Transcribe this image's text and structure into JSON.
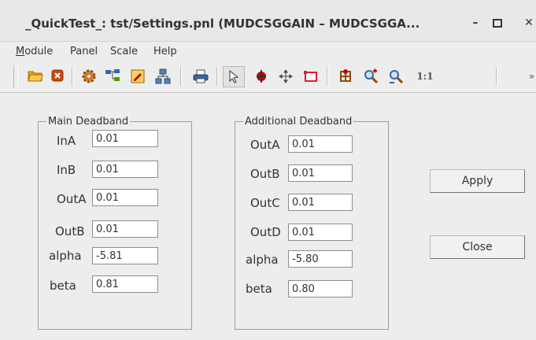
{
  "window": {
    "title": "_QuickTest_: tst/Settings.pnl (MUDCSGGAIN – MUDCSGGA...",
    "minimize_glyph": "–",
    "close_glyph": "✕"
  },
  "menu": [
    {
      "label": "Module",
      "accel": "M",
      "rest": "odule"
    },
    {
      "label": "Panel"
    },
    {
      "label": "Scale"
    },
    {
      "label": "Help"
    }
  ],
  "toolbar": {
    "icons": [
      "open-folder-icon",
      "stop-icon",
      "settings-gear-icon",
      "hierarchy-icon",
      "panel-edit-icon",
      "network-icon",
      "print-icon",
      "pointer-icon",
      "select-object-icon",
      "move-icon",
      "rectangle-icon",
      "grid-icon",
      "zoom-in-icon",
      "zoom-out-icon",
      "zoom-1-1-icon"
    ],
    "one_to_one_label": "1:1",
    "overflow_glyph": "»",
    "selected_tool": "pointer-icon",
    "colors": {
      "folder": "#e5a50a",
      "stop": "#cc4a0c",
      "rectangle": "#e01b24",
      "accent_blue": "#3465a4"
    }
  },
  "main_deadband": {
    "legend": "Main Deadband",
    "fields": [
      {
        "label": "InA",
        "value": "0.01"
      },
      {
        "label": "InB",
        "value": "0.01"
      },
      {
        "label": "OutA",
        "value": "0.01"
      },
      {
        "label": "OutB",
        "value": "0.01"
      },
      {
        "label": "alpha",
        "value": "-5.81"
      },
      {
        "label": "beta",
        "value": "0.81"
      }
    ]
  },
  "additional_deadband": {
    "legend": "Additional Deadband",
    "fields": [
      {
        "label": "OutA",
        "value": "0.01"
      },
      {
        "label": "OutB",
        "value": "0.01"
      },
      {
        "label": "OutC",
        "value": "0.01"
      },
      {
        "label": "OutD",
        "value": "0.01"
      },
      {
        "label": "alpha",
        "value": "-5.80"
      },
      {
        "label": "beta",
        "value": "0.80"
      }
    ]
  },
  "buttons": {
    "apply": "Apply",
    "close": "Close"
  }
}
